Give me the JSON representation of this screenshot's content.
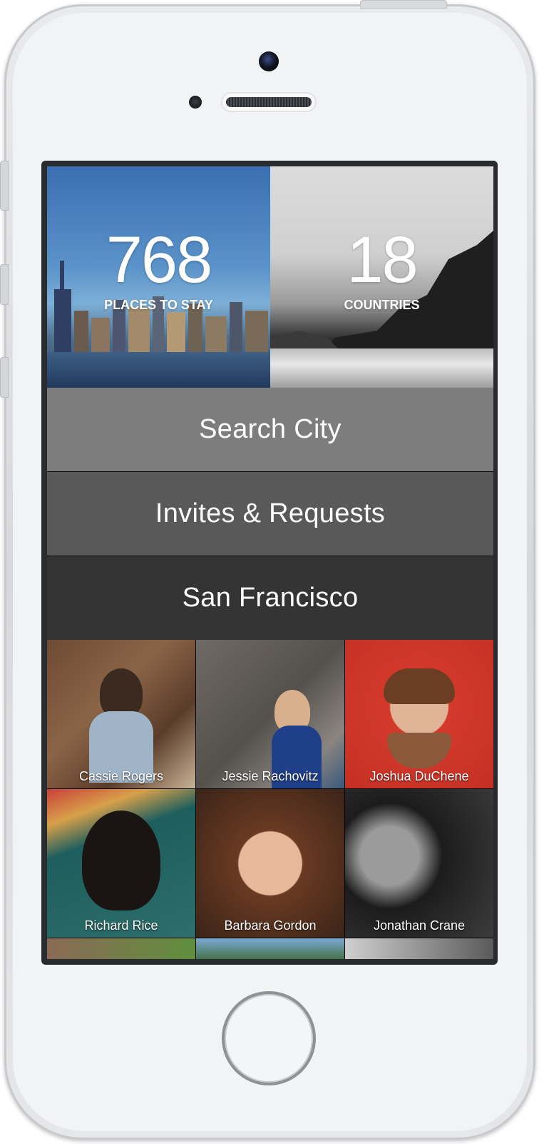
{
  "stats": [
    {
      "number": "768",
      "label": "PLACES TO STAY"
    },
    {
      "number": "18",
      "label": "COUNTRIES"
    }
  ],
  "menu": {
    "search_city": "Search City",
    "invites": "Invites & Requests",
    "current_city": "San Francisco"
  },
  "people": [
    {
      "name": "Cassie Rogers"
    },
    {
      "name": "Jessie Rachovitz"
    },
    {
      "name": "Joshua DuChene"
    },
    {
      "name": "Richard Rice"
    },
    {
      "name": "Barbara Gordon"
    },
    {
      "name": "Jonathan Crane"
    }
  ],
  "colors": {
    "menu_row_1": "#7d7d7d",
    "menu_row_2": "#595959",
    "menu_row_3": "#343434"
  }
}
